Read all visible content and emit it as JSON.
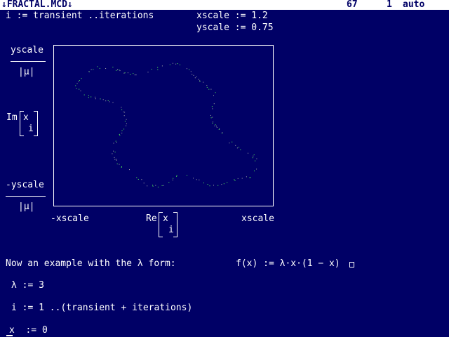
{
  "window": {
    "title": "↓FRACTAL.MCD↓",
    "line_number": "67",
    "page": "1",
    "mode": "auto"
  },
  "definitions": {
    "range": "i := transient ..iterations",
    "xscale": "xscale := 1.2",
    "yscale": "yscale := 0.75"
  },
  "plot": {
    "y_top_num": "yscale",
    "y_top_den": "|μ|",
    "y_mid_fn": "Im",
    "y_mid_var": "x",
    "y_mid_sub": "i",
    "y_bot_num": "-yscale",
    "y_bot_den": "|μ|",
    "x_left": "-xscale",
    "x_mid_fn": "Re",
    "x_mid_var": "x",
    "x_mid_sub": "i",
    "x_right": "xscale",
    "point_color": "#55ff55"
  },
  "text_lines": {
    "example": "Now an example with the λ form:",
    "function": "f(x) := λ·x·(1 − x)",
    "lambda_def": "λ := 3",
    "range_def": "i := 1 ..(transient + iterations)",
    "x0_def": "x  := 0"
  }
}
